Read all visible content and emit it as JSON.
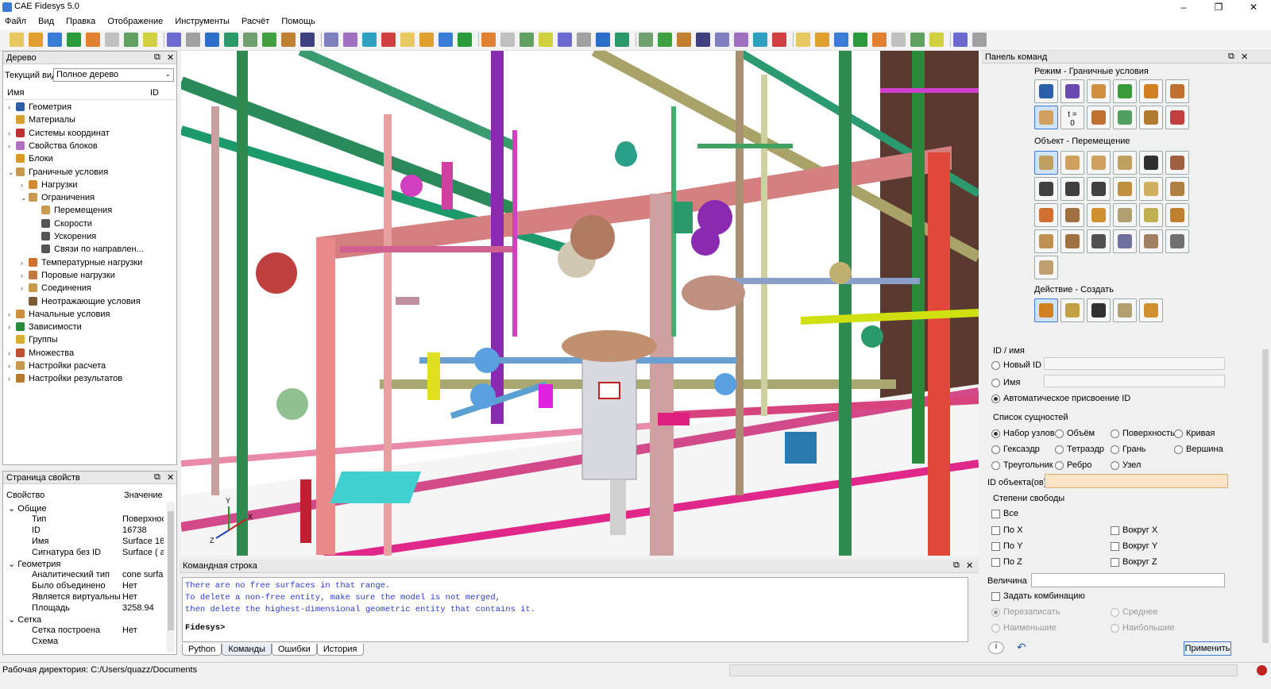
{
  "window": {
    "title": "CAE Fidesys 5.0",
    "minimize": "–",
    "maximize": "❐",
    "close": "✕"
  },
  "menu": [
    "Файл",
    "Вид",
    "Правка",
    "Отображение",
    "Инструменты",
    "Расчёт",
    "Помощь"
  ],
  "tree_panel": {
    "title": "Дерево",
    "view_label": "Текущий вид",
    "view_value": "Полное дерево",
    "col_name": "Имя",
    "col_id": "ID",
    "items": [
      {
        "label": "Геометрия",
        "arrow": "›",
        "icon": "geometry-icon",
        "color": "#2b5fa8"
      },
      {
        "label": "Материалы",
        "arrow": "",
        "icon": "materials-icon",
        "color": "#d8a030"
      },
      {
        "label": "Системы координат",
        "arrow": "›",
        "icon": "coordinate-systems-icon",
        "color": "#c03030"
      },
      {
        "label": "Свойства блоков",
        "arrow": "›",
        "icon": "block-properties-icon",
        "color": "#b070c0"
      },
      {
        "label": "Блоки",
        "arrow": "",
        "icon": "blocks-icon",
        "color": "#d89a20"
      },
      {
        "label": "Граничные условия",
        "arrow": "⌄",
        "icon": "boundary-conditions-icon",
        "color": "#c89a50"
      },
      {
        "label": "Нагрузки",
        "arrow": "›",
        "icon": "loads-icon",
        "color": "#d08a30"
      },
      {
        "label": "Ограничения",
        "arrow": "⌄",
        "icon": "constraints-icon",
        "color": "#c89a50"
      },
      {
        "label": "Перемещения",
        "arrow": "",
        "icon": "displacements-icon",
        "color": "#c89a50"
      },
      {
        "label": "Скорости",
        "arrow": "",
        "icon": "velocities-icon",
        "color": "#555"
      },
      {
        "label": "Ускорения",
        "arrow": "",
        "icon": "accelerations-icon",
        "color": "#555"
      },
      {
        "label": "Связи по направлен...",
        "arrow": "",
        "icon": "directional-links-icon",
        "color": "#555"
      },
      {
        "label": "Температурные нагрузки",
        "arrow": "›",
        "icon": "temperature-loads-icon",
        "color": "#d07030"
      },
      {
        "label": "Поровые нагрузки",
        "arrow": "›",
        "icon": "pore-loads-icon",
        "color": "#c07a40"
      },
      {
        "label": "Соединения",
        "arrow": "›",
        "icon": "connections-icon",
        "color": "#c89a50"
      },
      {
        "label": "Неотражающие условия",
        "arrow": "",
        "icon": "nonreflecting-icon",
        "color": "#7a5a30"
      },
      {
        "label": "Начальные условия",
        "arrow": "›",
        "icon": "initial-conditions-icon",
        "color": "#d09040"
      },
      {
        "label": "Зависимости",
        "arrow": "›",
        "icon": "dependencies-icon",
        "color": "#2a8a3a"
      },
      {
        "label": "Группы",
        "arrow": "",
        "icon": "groups-icon",
        "color": "#d8b030"
      },
      {
        "label": "Множества",
        "arrow": "›",
        "icon": "sets-icon",
        "color": "#c05030"
      },
      {
        "label": "Настройки расчета",
        "arrow": "›",
        "icon": "calc-settings-icon",
        "color": "#c89a50"
      },
      {
        "label": "Настройки результатов",
        "arrow": "›",
        "icon": "result-settings-icon",
        "color": "#b87a30"
      }
    ]
  },
  "props_panel": {
    "title": "Страница свойств",
    "col_prop": "Свойство",
    "col_val": "Значение",
    "rows": [
      {
        "name": "Общие",
        "value": "",
        "group": true
      },
      {
        "name": "Тип",
        "value": "Поверхнос",
        "group": false
      },
      {
        "name": "ID",
        "value": "16738",
        "group": false
      },
      {
        "name": "Имя",
        "value": "Surface 16",
        "group": false
      },
      {
        "name": "Сигнатура без ID",
        "value": "Surface ( a",
        "group": false
      },
      {
        "name": "Геометрия",
        "value": "",
        "group": true
      },
      {
        "name": "Аналитический тип",
        "value": "cone surfa",
        "group": false
      },
      {
        "name": "Было объединено",
        "value": "Нет",
        "group": false
      },
      {
        "name": "Является виртуальным",
        "value": "Нет",
        "group": false
      },
      {
        "name": "Площадь",
        "value": "3258.94",
        "group": false
      },
      {
        "name": "Сетка",
        "value": "",
        "group": true
      },
      {
        "name": "Сетка построена",
        "value": "Нет",
        "group": false
      },
      {
        "name": "Схема",
        "value": "",
        "group": false
      }
    ]
  },
  "console": {
    "title": "Командная строка",
    "lines": [
      "There are no free surfaces in that range.",
      "To delete a non-free entity, make sure the model is not merged,",
      "then delete the highest-dimensional geometric entity that contains it."
    ],
    "prompt": "Fidesys>",
    "tabs": [
      "Python",
      "Команды",
      "Ошибки",
      "История"
    ]
  },
  "command_panel": {
    "title": "Панель команд",
    "mode_label": "Режим - Граничные условия",
    "object_label": "Объект - Перемещение",
    "action_label": "Действие - Создать",
    "id_section": "ID / имя",
    "new_id": "Новый ID",
    "name": "Имя",
    "auto_id": "Автоматическое присвоение ID",
    "entity_list": "Список сущностей",
    "entities": [
      "Набор узлов",
      "Объём",
      "Поверхность",
      "Кривая",
      "Гексаэдр",
      "Тетраэдр",
      "Грань",
      "Вершина",
      "Треугольник",
      "Ребро",
      "Узел"
    ],
    "object_ids_label": "ID объекта(ов)",
    "dof_label": "Степени свободы",
    "dof_all": "Все",
    "dof": [
      "По X",
      "Вокруг X",
      "По Y",
      "Вокруг Y",
      "По Z",
      "Вокруг Z"
    ],
    "value_label": "Величина",
    "combination_label": "Задать комбинацию",
    "combo_options": [
      "Перезаписать",
      "Среднее",
      "Наименьшие",
      "Наибольшие"
    ],
    "apply": "Применить",
    "tcount": "t = 0"
  },
  "status": {
    "workdir": "Рабочая директория: C:/Users/quazz/Documents"
  },
  "axes": {
    "x": "X",
    "y": "Y",
    "z": "Z"
  }
}
